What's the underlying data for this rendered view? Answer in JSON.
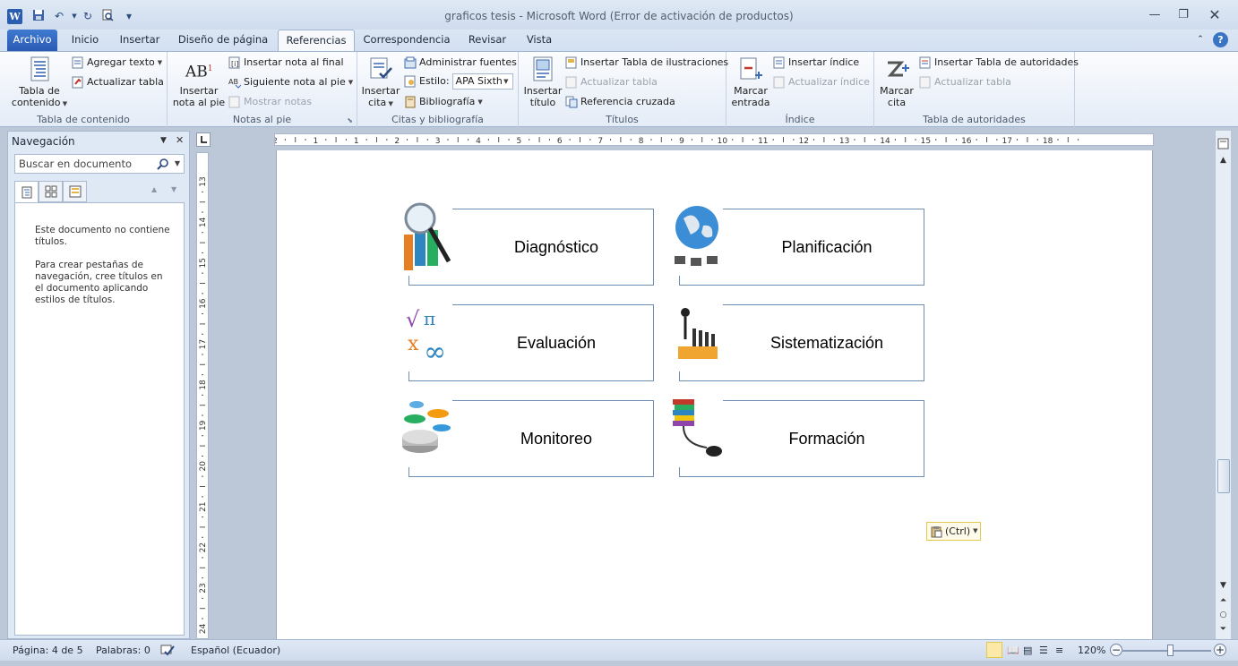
{
  "window": {
    "title": "graficos tesis  -  Microsoft Word (Error de activación de productos)",
    "app_icon_letter": "W"
  },
  "tabs": [
    "Archivo",
    "Inicio",
    "Insertar",
    "Diseño de página",
    "Referencias",
    "Correspondencia",
    "Revisar",
    "Vista"
  ],
  "active_tab": "Referencias",
  "ribbon": {
    "toc": {
      "big_label_1": "Tabla de",
      "big_label_2": "contenido",
      "add_text": "Agregar texto",
      "update_table": "Actualizar tabla",
      "group": "Tabla de contenido"
    },
    "footnotes": {
      "insert_1": "Insertar",
      "insert_2": "nota al pie",
      "endnote": "Insertar nota al final",
      "next_note": "Siguiente nota al pie",
      "show_notes": "Mostrar notas",
      "group": "Notas al pie",
      "icon_text": "AB"
    },
    "citations": {
      "insert_1": "Insertar",
      "insert_2": "cita",
      "manage": "Administrar fuentes",
      "style_label": "Estilo:",
      "style_value": "APA Sixth",
      "bibliography": "Bibliografía",
      "group": "Citas y bibliografía"
    },
    "captions": {
      "insert_1": "Insertar",
      "insert_2": "título",
      "table_fig": "Insertar Tabla de ilustraciones",
      "update_table": "Actualizar tabla",
      "cross_ref": "Referencia cruzada",
      "group": "Títulos"
    },
    "index": {
      "mark_1": "Marcar",
      "mark_2": "entrada",
      "insert_index": "Insertar índice",
      "update_index": "Actualizar índice",
      "group": "Índice"
    },
    "authorities": {
      "mark_1": "Marcar",
      "mark_2": "cita",
      "insert_table": "Insertar Tabla de autoridades",
      "update_table": "Actualizar tabla",
      "group": "Tabla de autoridades"
    }
  },
  "navigation": {
    "title": "Navegación",
    "search_placeholder": "Buscar en documento",
    "message_1": "Este documento no contiene títulos.",
    "message_2": "Para crear pestañas de navegación, cree títulos en el documento aplicando estilos de títulos."
  },
  "ruler": {
    "h_ticks": [
      "2",
      "1",
      "1",
      "2",
      "3",
      "4",
      "5",
      "6",
      "7",
      "8",
      "9",
      "10",
      "11",
      "12",
      "13",
      "14",
      "15",
      "16",
      "17",
      "18"
    ],
    "v_ticks": [
      "13",
      "14",
      "15",
      "16",
      "17",
      "18",
      "19",
      "20",
      "21",
      "22",
      "23",
      "24"
    ]
  },
  "diagram": {
    "cards": [
      {
        "label": "Diagnóstico",
        "icon": "magnifier-chart-icon"
      },
      {
        "label": "Planificación",
        "icon": "globe-network-icon"
      },
      {
        "label": "Evaluación",
        "icon": "math-symbols-icon"
      },
      {
        "label": "Sistematización",
        "icon": "figure-dominoes-icon"
      },
      {
        "label": "Monitoreo",
        "icon": "pie-chart-icon"
      },
      {
        "label": "Formación",
        "icon": "books-mouse-icon"
      }
    ]
  },
  "paste_options": "(Ctrl)",
  "status": {
    "page": "Página: 4 de 5",
    "words": "Palabras: 0",
    "language": "Español (Ecuador)",
    "zoom": "120%",
    "zoom_level_percent": 120
  },
  "colors": {
    "archivo_tab": "#2a5ab4",
    "card_border": "#6d8fb7",
    "paste_border": "#e3c84f"
  }
}
